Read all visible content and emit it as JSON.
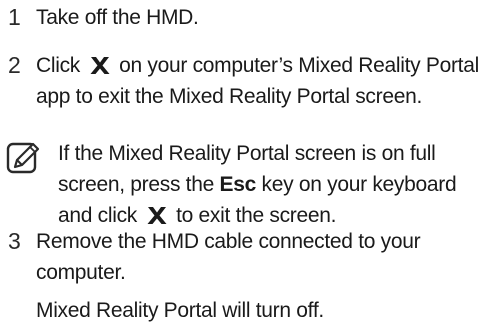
{
  "steps": [
    {
      "number": "1",
      "line1": "Take off the HMD."
    },
    {
      "number": "2",
      "line1_before": "Click",
      "line1_after": "on your computer’s Mixed Reality Portal",
      "line2": "app to exit the Mixed Reality Portal screen."
    },
    {
      "number": "3",
      "line1": "Remove the HMD cable connected to your",
      "line2": "computer.",
      "line3": "Mixed Reality Portal will turn off."
    }
  ],
  "note": {
    "icon": "note-pencil-icon",
    "line1": "If the Mixed Reality Portal screen is on full",
    "line2_before": "screen, press the",
    "line2_key": "Esc",
    "line2_after": "key on your keyboard",
    "line3_before": "and click",
    "line3_after": "to exit the screen."
  },
  "icons": {
    "close": "close-icon"
  }
}
